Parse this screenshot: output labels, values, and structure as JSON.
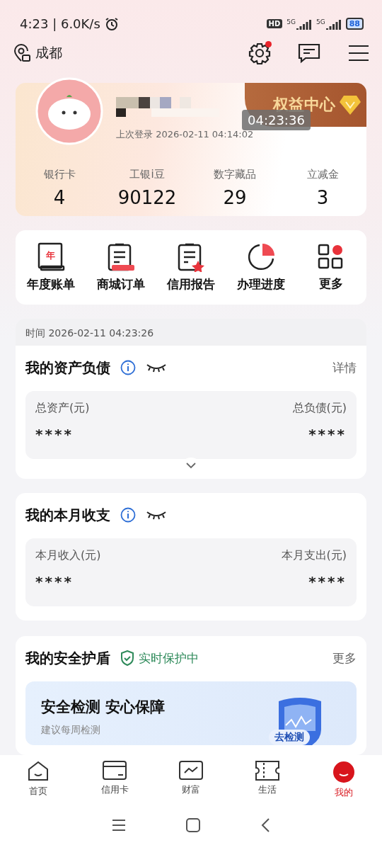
{
  "status_bar": {
    "time": "4:23 | 6.0K/s",
    "hd": "HD",
    "networks": [
      "5G",
      "5G"
    ],
    "battery": "88"
  },
  "top_bar": {
    "city": "成都",
    "settings_badge": true
  },
  "profile": {
    "last_login": "上次登录 2026-02-11 04:14:02",
    "rights_badge": "权益中心",
    "timer": "04:23:36",
    "stats": [
      {
        "label": "银行卡",
        "value": "4"
      },
      {
        "label": "工银i豆",
        "value": "90122"
      },
      {
        "label": "数字藏品",
        "value": "29"
      },
      {
        "label": "立减金",
        "value": "3"
      }
    ]
  },
  "shortcuts": [
    {
      "label": "年度账单",
      "kind": "bill",
      "icon_text": "年"
    },
    {
      "label": "商城订单",
      "kind": "order"
    },
    {
      "label": "信用报告",
      "kind": "report"
    },
    {
      "label": "办理进度",
      "kind": "progress"
    },
    {
      "label": "更多",
      "kind": "more"
    }
  ],
  "timestamp": "时间 2026-02-11 04:23:26",
  "assets": {
    "title": "我的资产负债",
    "link": "详情",
    "left_label": "总资产(元)",
    "left_value": "****",
    "right_label": "总负债(元)",
    "right_value": "****"
  },
  "income": {
    "title": "我的本月收支",
    "left_label": "本月收入(元)",
    "left_value": "****",
    "right_label": "本月支出(元)",
    "right_value": "****"
  },
  "security": {
    "title": "我的安全护盾",
    "status": "实时保护中",
    "link": "更多",
    "banner_title": "安全检测 安心保障",
    "banner_subtitle": "建议每周检测",
    "action": "去检测"
  },
  "tab_bar": [
    {
      "label": "首页",
      "kind": "home",
      "selected": false
    },
    {
      "label": "信用卡",
      "kind": "card",
      "selected": false
    },
    {
      "label": "财富",
      "kind": "wealth",
      "selected": false
    },
    {
      "label": "生活",
      "kind": "life",
      "selected": false
    },
    {
      "label": "我的",
      "kind": "mine",
      "selected": true
    }
  ]
}
